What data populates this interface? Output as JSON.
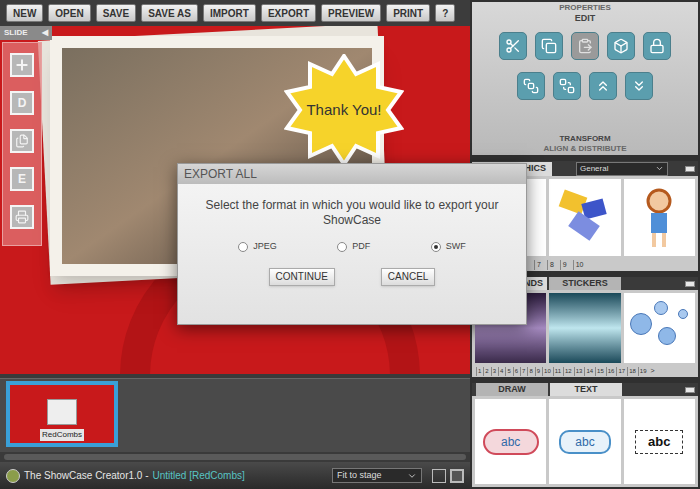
{
  "toolbar": [
    "NEW",
    "OPEN",
    "SAVE",
    "SAVE AS",
    "IMPORT",
    "EXPORT",
    "PREVIEW",
    "PRINT",
    "?"
  ],
  "slide_tab": {
    "label": "SLIDE",
    "arrow": "◀"
  },
  "sidebar": [
    {
      "kind": "add"
    },
    {
      "kind": "letter",
      "label": "D"
    },
    {
      "kind": "pages"
    },
    {
      "kind": "letter",
      "label": "E"
    },
    {
      "kind": "print"
    }
  ],
  "canvas": {
    "sticker_text": "Thank You!"
  },
  "slides": [
    {
      "label": "RedCombs",
      "selected": true
    }
  ],
  "status_bar": {
    "app": "The ShowCase Creator1.0 -",
    "document": "Untitled [RedCombs]",
    "zoom": "Fit to stage"
  },
  "properties": {
    "title": "PROPERTIES",
    "section": "EDIT",
    "edit_buttons": [
      {
        "kind": "cut",
        "disabled": false
      },
      {
        "kind": "copy",
        "disabled": false
      },
      {
        "kind": "paste",
        "disabled": true
      },
      {
        "kind": "group",
        "disabled": false
      },
      {
        "kind": "lock",
        "disabled": false
      }
    ],
    "arrange_buttons": [
      {
        "kind": "front",
        "disabled": false
      },
      {
        "kind": "back",
        "disabled": false
      },
      {
        "kind": "forward",
        "disabled": false
      },
      {
        "kind": "backward",
        "disabled": false
      }
    ],
    "footer_title": "TRANSFORM",
    "footer_section": "ALIGN & DISTRIBUTE"
  },
  "graphics": {
    "tab": "HICS",
    "category": "General",
    "pages": [
      "7",
      "8",
      "9",
      "10"
    ]
  },
  "backgrounds": {
    "tabs": [
      {
        "label": "ROUNDS",
        "selected": true
      },
      {
        "label": "STICKERS",
        "selected": false
      }
    ],
    "pages": [
      "1",
      "2",
      "3",
      "4",
      "5",
      "6",
      "7",
      "8",
      "9",
      "10",
      "11",
      "12",
      "13",
      "14",
      "15",
      "16",
      "17",
      "18",
      "19"
    ],
    "next": ">"
  },
  "text_panel": {
    "tabs": [
      {
        "label": "DRAW",
        "selected": false
      },
      {
        "label": "TEXT",
        "selected": true
      }
    ],
    "items": [
      "abc",
      "abc",
      "abc"
    ]
  },
  "dialog": {
    "title": "EXPORT ALL",
    "message": "Select the format in which you would like to export your ShowCase",
    "options": [
      {
        "label": "JPEG",
        "selected": false
      },
      {
        "label": "PDF",
        "selected": false
      },
      {
        "label": "SWF",
        "selected": true
      }
    ],
    "buttons": [
      "CONTINUE",
      "CANCEL"
    ]
  }
}
